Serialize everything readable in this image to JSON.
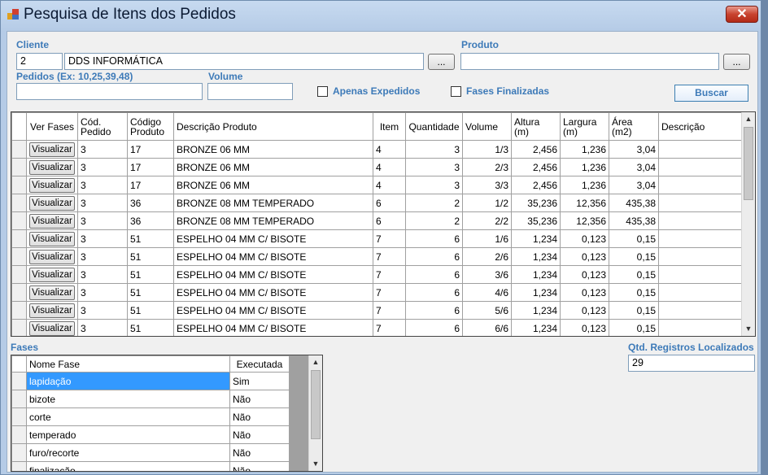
{
  "window": {
    "title": "Pesquisa de Itens dos Pedidos",
    "close_glyph": "✕"
  },
  "filters": {
    "cliente_label": "Cliente",
    "cliente_code": "2",
    "cliente_name": "DDS INFORMÁTICA",
    "cliente_lookup": "...",
    "produto_label": "Produto",
    "produto_value": "",
    "produto_lookup": "...",
    "pedidos_label": "Pedidos (Ex: 10,25,39,48)",
    "pedidos_value": "",
    "volume_label": "Volume",
    "volume_value": "",
    "apenas_expedidos": "Apenas Expedidos",
    "fases_finalizadas": "Fases Finalizadas",
    "buscar": "Buscar"
  },
  "items_grid": {
    "headers": {
      "ver_fases": "Ver Fases",
      "cod_pedido": "Cód.\nPedido",
      "codigo_produto": "Código\nProduto",
      "descricao_produto": "Descrição Produto",
      "item": "Item",
      "quantidade": "Quantidade",
      "volume": "Volume",
      "altura": "Altura\n(m)",
      "largura": "Largura\n(m)",
      "area": "Área\n(m2)",
      "descricao": "Descrição"
    },
    "button_label": "Visualizar",
    "rows": [
      {
        "pedido": "3",
        "produto": "17",
        "desc": "BRONZE 06 MM",
        "item": "4",
        "qtd": "3",
        "vol": "1/3",
        "alt": "2,456",
        "larg": "1,236",
        "area": "3,04",
        "obs": ""
      },
      {
        "pedido": "3",
        "produto": "17",
        "desc": "BRONZE 06 MM",
        "item": "4",
        "qtd": "3",
        "vol": "2/3",
        "alt": "2,456",
        "larg": "1,236",
        "area": "3,04",
        "obs": ""
      },
      {
        "pedido": "3",
        "produto": "17",
        "desc": "BRONZE 06 MM",
        "item": "4",
        "qtd": "3",
        "vol": "3/3",
        "alt": "2,456",
        "larg": "1,236",
        "area": "3,04",
        "obs": ""
      },
      {
        "pedido": "3",
        "produto": "36",
        "desc": "BRONZE 08 MM TEMPERADO",
        "item": "6",
        "qtd": "2",
        "vol": "1/2",
        "alt": "35,236",
        "larg": "12,356",
        "area": "435,38",
        "obs": ""
      },
      {
        "pedido": "3",
        "produto": "36",
        "desc": "BRONZE 08 MM TEMPERADO",
        "item": "6",
        "qtd": "2",
        "vol": "2/2",
        "alt": "35,236",
        "larg": "12,356",
        "area": "435,38",
        "obs": ""
      },
      {
        "pedido": "3",
        "produto": "51",
        "desc": "ESPELHO 04 MM C/ BISOTE",
        "item": "7",
        "qtd": "6",
        "vol": "1/6",
        "alt": "1,234",
        "larg": "0,123",
        "area": "0,15",
        "obs": ""
      },
      {
        "pedido": "3",
        "produto": "51",
        "desc": "ESPELHO 04 MM C/ BISOTE",
        "item": "7",
        "qtd": "6",
        "vol": "2/6",
        "alt": "1,234",
        "larg": "0,123",
        "area": "0,15",
        "obs": ""
      },
      {
        "pedido": "3",
        "produto": "51",
        "desc": "ESPELHO 04 MM C/ BISOTE",
        "item": "7",
        "qtd": "6",
        "vol": "3/6",
        "alt": "1,234",
        "larg": "0,123",
        "area": "0,15",
        "obs": ""
      },
      {
        "pedido": "3",
        "produto": "51",
        "desc": "ESPELHO 04 MM C/ BISOTE",
        "item": "7",
        "qtd": "6",
        "vol": "4/6",
        "alt": "1,234",
        "larg": "0,123",
        "area": "0,15",
        "obs": ""
      },
      {
        "pedido": "3",
        "produto": "51",
        "desc": "ESPELHO 04 MM C/ BISOTE",
        "item": "7",
        "qtd": "6",
        "vol": "5/6",
        "alt": "1,234",
        "larg": "0,123",
        "area": "0,15",
        "obs": ""
      },
      {
        "pedido": "3",
        "produto": "51",
        "desc": "ESPELHO 04 MM C/ BISOTE",
        "item": "7",
        "qtd": "6",
        "vol": "6/6",
        "alt": "1,234",
        "larg": "0,123",
        "area": "0,15",
        "obs": ""
      }
    ]
  },
  "fases": {
    "label": "Fases",
    "headers": {
      "nome": "Nome Fase",
      "executada": "Executada"
    },
    "rows": [
      {
        "nome": "lapidação",
        "executada": "Sim",
        "selected": true
      },
      {
        "nome": "bizote",
        "executada": "Não"
      },
      {
        "nome": "corte",
        "executada": "Não"
      },
      {
        "nome": "temperado",
        "executada": "Não"
      },
      {
        "nome": "furo/recorte",
        "executada": "Não"
      },
      {
        "nome": "finalização",
        "executada": "Não"
      }
    ]
  },
  "registros": {
    "label": "Qtd. Registros Localizados",
    "value": "29"
  },
  "colors": {
    "accent": "#3d7ab8",
    "selection": "#3399ff",
    "close": "#c8432f"
  },
  "icons": {
    "app": "app-icon",
    "up": "scroll-up-icon",
    "down": "scroll-down-icon"
  }
}
